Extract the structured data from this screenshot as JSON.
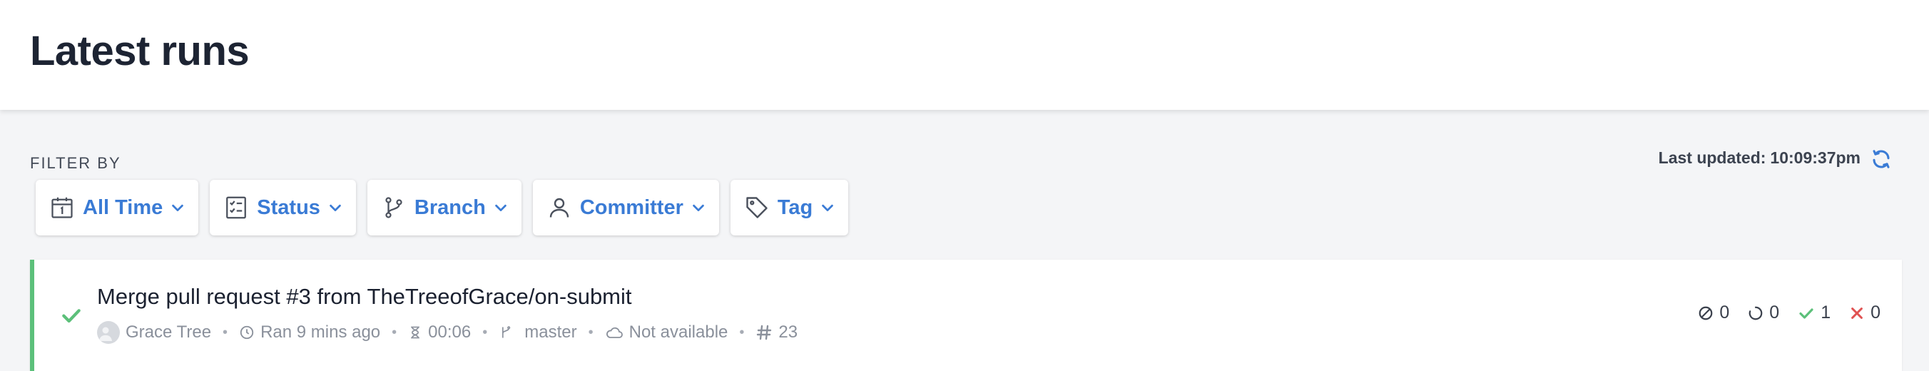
{
  "header": {
    "title": "Latest runs"
  },
  "filters": {
    "label": "FILTER BY",
    "items": [
      {
        "label": "All Time",
        "icon": "calendar-icon"
      },
      {
        "label": "Status",
        "icon": "checklist-icon"
      },
      {
        "label": "Branch",
        "icon": "branch-icon"
      },
      {
        "label": "Committer",
        "icon": "user-icon"
      },
      {
        "label": "Tag",
        "icon": "tag-icon"
      }
    ]
  },
  "last_updated": {
    "label": "Last updated:",
    "time": "10:09:37pm"
  },
  "runs": [
    {
      "title": "Merge pull request #3 from TheTreeofGrace/on-submit",
      "status": "passed",
      "author": "Grace Tree",
      "ran": "Ran 9 mins ago",
      "duration": "00:06",
      "branch": "master",
      "ci": "Not available",
      "run_number": "23",
      "counts": {
        "skipped": "0",
        "pending": "0",
        "passed": "1",
        "failed": "0"
      }
    }
  ],
  "colors": {
    "accent": "#3a7bd5",
    "success": "#5cc07a",
    "failure": "#e05252"
  }
}
